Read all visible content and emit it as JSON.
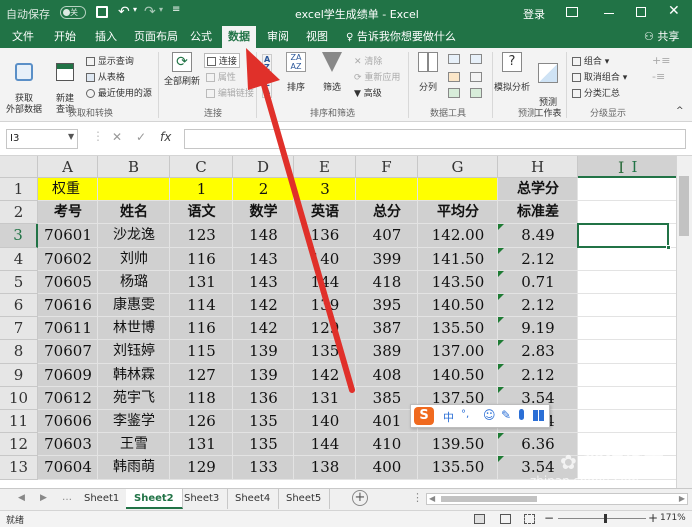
{
  "titlebar": {
    "autosave": "自动保存",
    "toggle": "关",
    "title": "excel学生成绩单 - Excel",
    "login": "登录"
  },
  "tabs": [
    "文件",
    "开始",
    "插入",
    "页面布局",
    "公式",
    "数据",
    "审阅",
    "视图"
  ],
  "tell_me": "告诉我你想要做什么",
  "share": "共享",
  "ribbon": {
    "get_data": "获取\n外部数据",
    "new_query": "新建\n查询",
    "show_query": "显示查询",
    "from_table": "从表格",
    "recent_sources": "最近使用的源",
    "group_get": "获取和转换",
    "refresh_all": "全部刷新",
    "connections": "连接",
    "properties": "属性",
    "edit_links": "编辑链接",
    "group_conn": "连接",
    "sort": "排序",
    "filter": "筛选",
    "clear": "清除",
    "reapply": "重新应用",
    "advanced": "高级",
    "group_sort": "排序和筛选",
    "text_to_columns": "分列",
    "group_tools": "数据工具",
    "what_if": "模拟分析",
    "forecast_sheet": "预测\n工作表",
    "group_forecast": "预测",
    "group": "组合",
    "ungroup": "取消组合",
    "subtotal": "分类汇总",
    "group_outline": "分级显示"
  },
  "namebox": "I3",
  "columns": [
    "A",
    "B",
    "C",
    "D",
    "E",
    "F",
    "G",
    "H",
    "I"
  ],
  "rows": [
    [
      "权重",
      "",
      "1",
      "2",
      "3",
      "",
      "",
      "总学分",
      ""
    ],
    [
      "考号",
      "姓名",
      "语文",
      "数学",
      "英语",
      "总分",
      "平均分",
      "标准差",
      ""
    ],
    [
      "70601",
      "沙龙逸",
      "123",
      "148",
      "136",
      "407",
      "142.00",
      "8.49",
      ""
    ],
    [
      "70602",
      "刘帅",
      "116",
      "143",
      "140",
      "399",
      "141.50",
      "2.12",
      ""
    ],
    [
      "70605",
      "杨璐",
      "131",
      "143",
      "144",
      "418",
      "143.50",
      "0.71",
      ""
    ],
    [
      "70616",
      "康惠雯",
      "114",
      "142",
      "139",
      "395",
      "140.50",
      "2.12",
      ""
    ],
    [
      "70611",
      "林世博",
      "116",
      "142",
      "129",
      "387",
      "135.50",
      "9.19",
      ""
    ],
    [
      "70607",
      "刘钰婷",
      "115",
      "139",
      "135",
      "389",
      "137.00",
      "2.83",
      ""
    ],
    [
      "70609",
      "韩林霖",
      "127",
      "139",
      "142",
      "408",
      "140.50",
      "2.12",
      ""
    ],
    [
      "70612",
      "苑宇飞",
      "118",
      "136",
      "131",
      "385",
      "137.50",
      "3.54",
      ""
    ],
    [
      "70606",
      "李鉴学",
      "126",
      "135",
      "140",
      "401",
      "137.50",
      "3.54",
      ""
    ],
    [
      "70603",
      "王雪",
      "131",
      "135",
      "144",
      "410",
      "139.50",
      "6.36",
      ""
    ],
    [
      "70604",
      "韩雨萌",
      "129",
      "133",
      "138",
      "400",
      "135.50",
      "3.54",
      ""
    ]
  ],
  "row_numbers": [
    "1",
    "2",
    "3",
    "4",
    "5",
    "6",
    "7",
    "8",
    "9",
    "10",
    "11",
    "12",
    "13"
  ],
  "sheets": [
    "Sheet1",
    "Sheet2",
    "Sheet3",
    "Sheet4",
    "Sheet5"
  ],
  "active_sheet": "Sheet2",
  "status": {
    "ready": "就绪",
    "zoom": "171%"
  },
  "ime": {
    "zhong": "中",
    "dot": "°,"
  },
  "watermark": {
    "line1": "搜狗指南",
    "line2": "zhinan.sogou.com"
  },
  "colors": {
    "excel_green": "#217346",
    "header_yellow": "#ffff00",
    "selected_gray": "#d0d0d0",
    "arrow_red": "#e0302a"
  }
}
